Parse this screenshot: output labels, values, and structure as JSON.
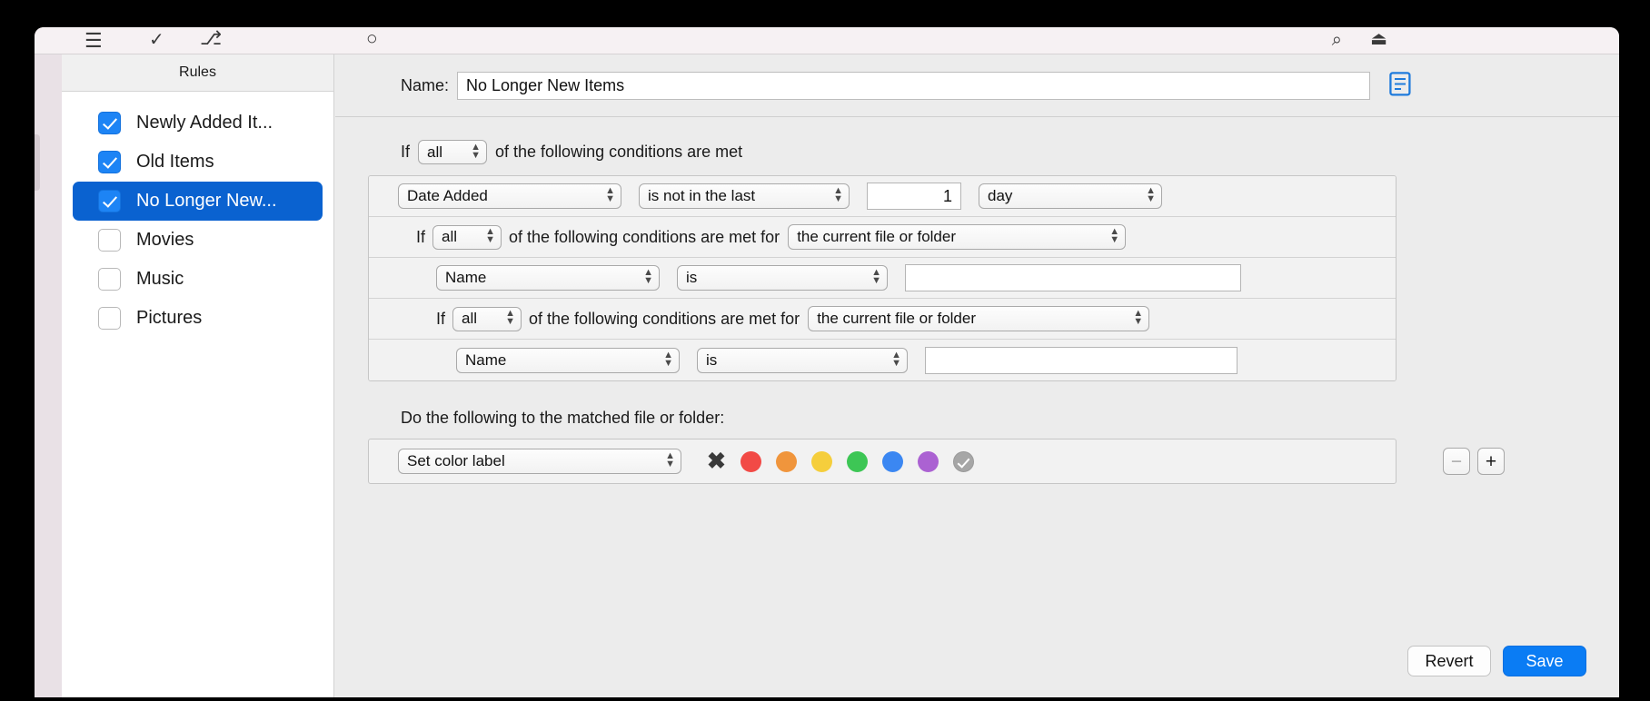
{
  "toolbar": {
    "icons": [
      "hamburger-icon",
      "check-icon",
      "sliders-icon",
      "clock-icon",
      "search-icon",
      "export-icon"
    ],
    "hamburger": "☰",
    "check": "✓",
    "sliders": "⎇",
    "clock": "○",
    "search": "⌕",
    "export": "⏏"
  },
  "sidebar": {
    "header": "Rules",
    "items": [
      {
        "label": "Newly Added It...",
        "checked": true,
        "selected": false
      },
      {
        "label": "Old Items",
        "checked": true,
        "selected": false
      },
      {
        "label": "No Longer New...",
        "checked": true,
        "selected": true
      },
      {
        "label": "Movies",
        "checked": false,
        "selected": false
      },
      {
        "label": "Music",
        "checked": false,
        "selected": false
      },
      {
        "label": "Pictures",
        "checked": false,
        "selected": false
      }
    ]
  },
  "detail": {
    "name_label": "Name:",
    "name_value": "No Longer New Items",
    "doc_icon": "὜E",
    "if_prefix": "If",
    "if_match": "all",
    "if_suffix": "of the following conditions are met",
    "conditions": [
      {
        "kind": "condition",
        "indent": 1,
        "attribute": "Date Added",
        "operator": "is not in the last",
        "number": "1",
        "unit": "day"
      },
      {
        "kind": "nested-if",
        "indent": 2,
        "if_prefix": "If",
        "match": "all",
        "middle": "of the following conditions are met for",
        "scope": "the current file or folder"
      },
      {
        "kind": "condition-text",
        "indent": 3,
        "attribute": "Name",
        "operator": "is",
        "value": ""
      },
      {
        "kind": "nested-if",
        "indent": 3,
        "if_prefix": "If",
        "match": "all",
        "middle": "of the following conditions are met for",
        "scope": "the current file or folder"
      },
      {
        "kind": "condition-text",
        "indent": 4,
        "attribute": "Name",
        "operator": "is",
        "value": ""
      }
    ],
    "minus_label": "−",
    "plus_label": "+",
    "action_title": "Do the following to the matched file or folder:",
    "action": {
      "type": "Set color label",
      "clear_glyph": "✖",
      "colors": [
        {
          "name": "red-color-swatch",
          "hex": "#f24a46"
        },
        {
          "name": "orange-color-swatch",
          "hex": "#f0953c"
        },
        {
          "name": "yellow-color-swatch",
          "hex": "#f5ce3c"
        },
        {
          "name": "green-color-swatch",
          "hex": "#3dc655"
        },
        {
          "name": "blue-color-swatch",
          "hex": "#3b87f2"
        },
        {
          "name": "purple-color-swatch",
          "hex": "#ab62d2"
        },
        {
          "name": "gray-selected-color-swatch",
          "hex": "#a6a6a6"
        }
      ]
    }
  },
  "footer": {
    "revert": "Revert",
    "save": "Save"
  }
}
